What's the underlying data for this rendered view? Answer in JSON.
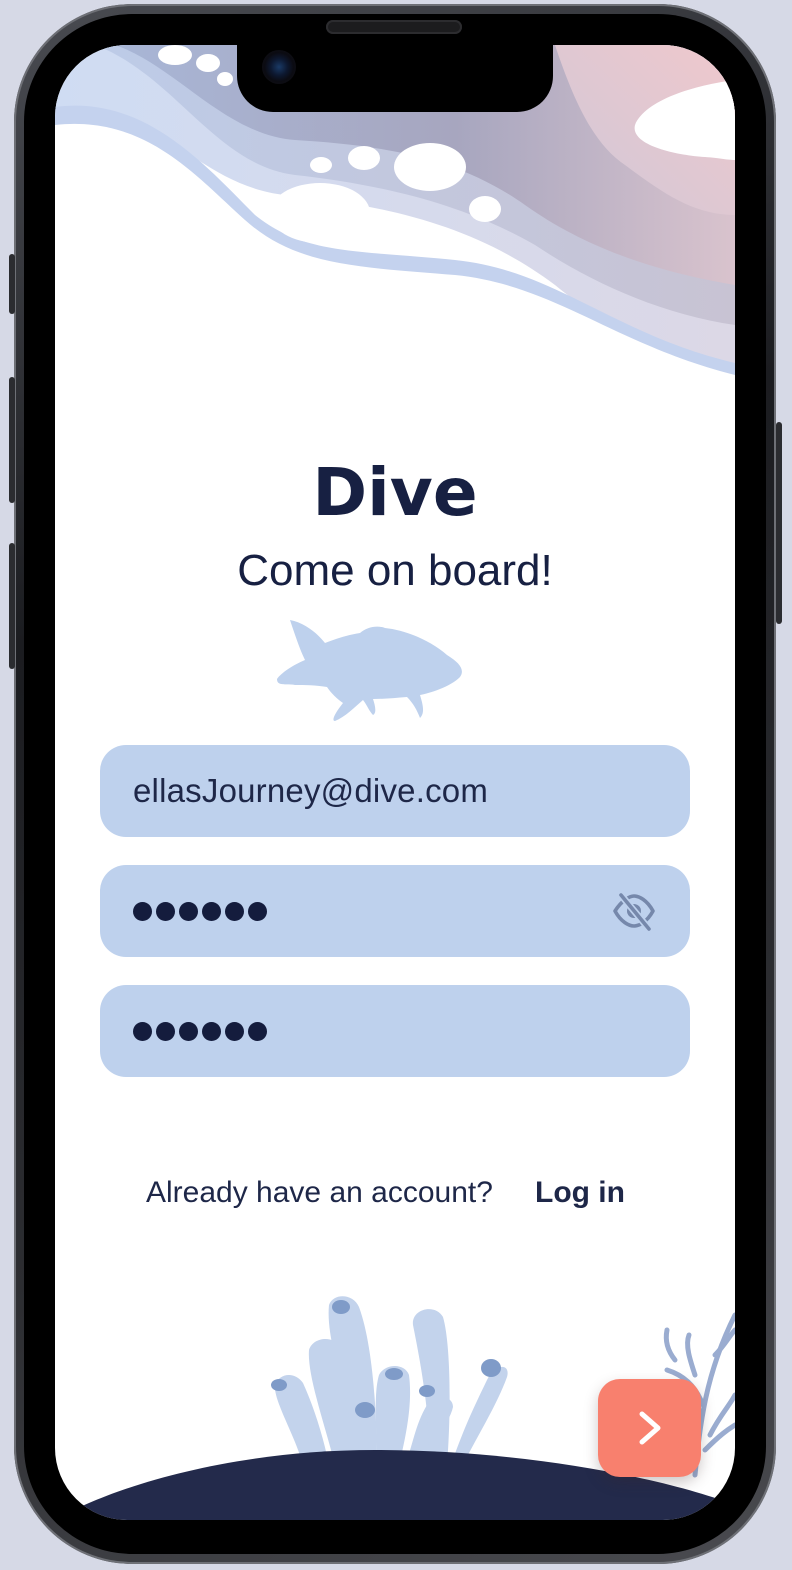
{
  "app": {
    "title": "Dive",
    "subtitle": "Come on board!"
  },
  "form": {
    "email_value": "ellasJourney@dive.com",
    "password_dot_count": 6,
    "confirm_password_dot_count": 6
  },
  "footer": {
    "prompt": "Already have an account?",
    "login_label": "Log in"
  },
  "icons": {
    "password_visibility": "eye-slash-icon",
    "next": "chevron-right-icon",
    "illustration": "fish-icon"
  },
  "colors": {
    "primary_dark": "#172042",
    "field_bg": "#bed1ed",
    "accent": "#f8806e",
    "seafloor": "#232a4b"
  }
}
